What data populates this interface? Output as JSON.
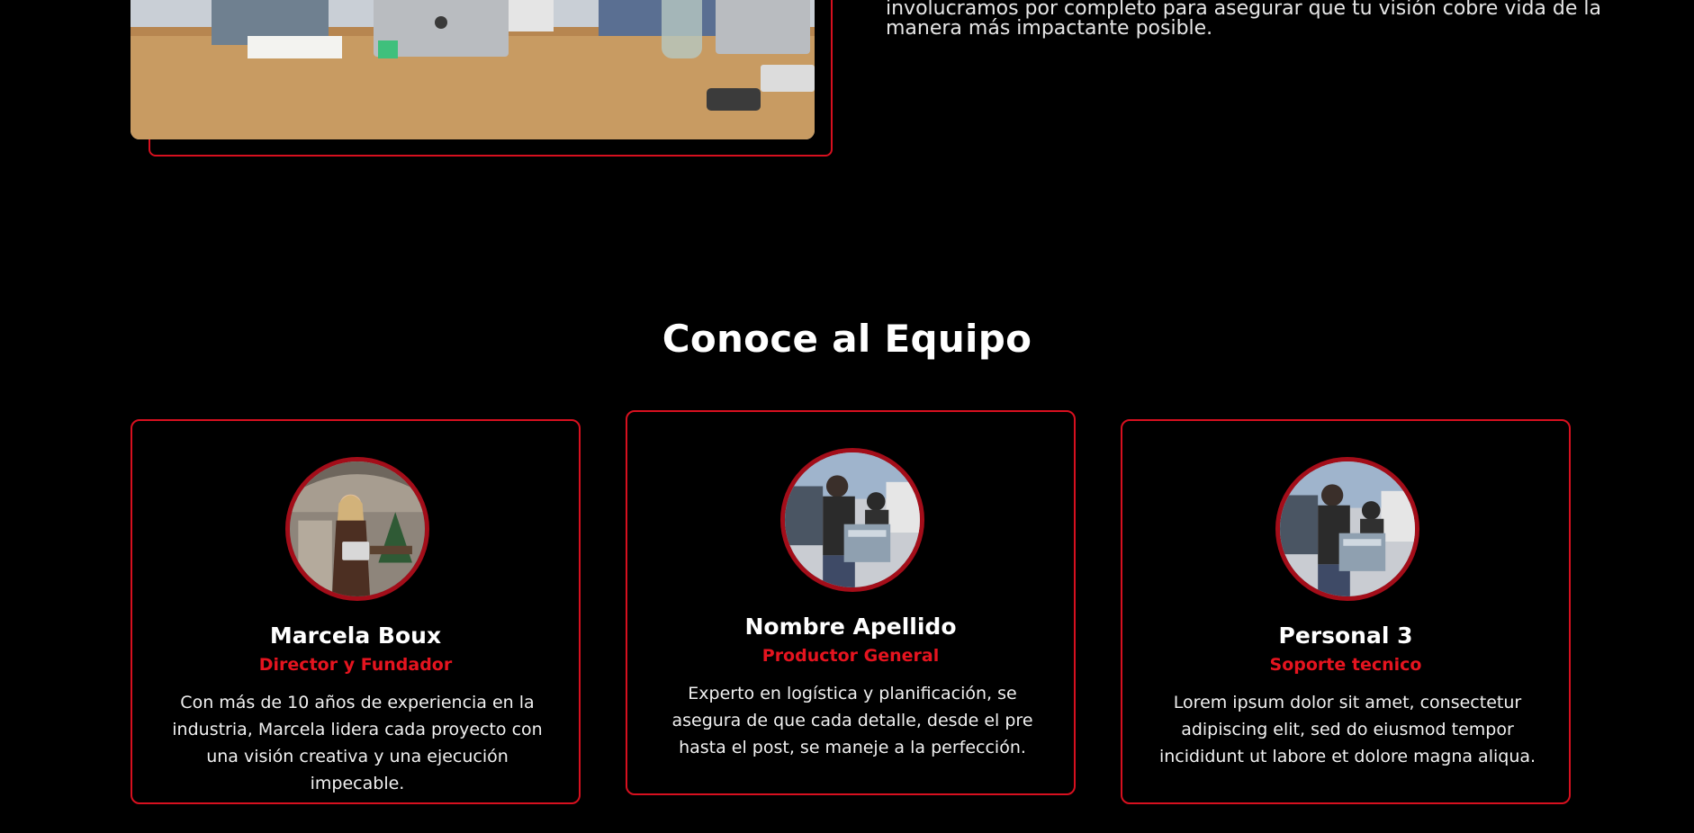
{
  "about": {
    "text_line1": "involucramos por completo para asegurar que tu visión cobre vida de la",
    "text_line2": "manera más impactante posible.",
    "photo_icon": "office-teamwork-photo"
  },
  "team": {
    "title": "Conoce al Equipo",
    "members": [
      {
        "name": "Marcela Boux",
        "role": "Director y Fundador",
        "bio": "Con más de 10 años de experiencia en la industria, Marcela lidera cada proyecto con una visión creativa y una ejecución impecable.",
        "photo": "woman-portrait-photo"
      },
      {
        "name": "Nombre Apellido",
        "role": "Productor General",
        "bio": "Experto en logística y planificación, se asegura de que cada detalle, desde el pre hasta el post, se maneje a la perfección.",
        "photo": "workers-loading-photo"
      },
      {
        "name": "Personal 3",
        "role": "Soporte tecnico",
        "bio": "Lorem ipsum dolor sit amet, consectetur adipiscing elit, sed do eiusmod tempor incididunt ut labore et dolore magna aliqua.",
        "photo": "workers-loading-photo"
      }
    ]
  },
  "colors": {
    "background": "#000000",
    "accent": "#d7101f",
    "avatar_border": "#a30d19"
  }
}
